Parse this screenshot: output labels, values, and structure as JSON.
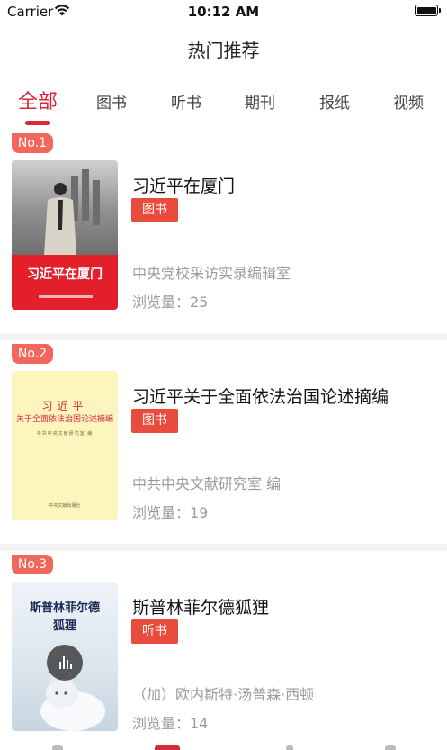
{
  "status_bar": {
    "carrier": "Carrier",
    "time": "10:12 AM",
    "wifi_icon": "wifi-icon",
    "battery_icon": "battery-icon"
  },
  "nav": {
    "title": "热门推荐"
  },
  "tabs": [
    {
      "label": "全部",
      "active": true
    },
    {
      "label": "图书",
      "active": false
    },
    {
      "label": "听书",
      "active": false
    },
    {
      "label": "期刊",
      "active": false
    },
    {
      "label": "报纸",
      "active": false
    },
    {
      "label": "视频",
      "active": false
    }
  ],
  "accent_color": "#d8283a",
  "tag_color": "#e94b3c",
  "rank_color": "#f3665c",
  "items": [
    {
      "rank": "No.1",
      "title": "习近平在厦门",
      "type": "图书",
      "author": "中央党校采访实录编辑室",
      "views": "浏览量：25",
      "cover_title": "习近平在厦门"
    },
    {
      "rank": "No.2",
      "title": "习近平关于全面依法治国论述摘编",
      "type": "图书",
      "author": "中共中央文献研究室 编",
      "views": "浏览量：19",
      "cover_title_line1": "习近平",
      "cover_title_line2": "关于全面依法治国论述摘编",
      "cover_editor": "中共中央文献研究室 编",
      "cover_publisher": "中央文献出版社"
    },
    {
      "rank": "No.3",
      "title": "斯普林菲尔德狐狸",
      "type": "听书",
      "author": "（加）欧内斯特·汤普森·西顿",
      "views": "浏览量：14",
      "cover_title_line1": "斯普林菲尔德",
      "cover_title_line2": "狐狸",
      "audio_icon": "audio-play-icon"
    }
  ]
}
